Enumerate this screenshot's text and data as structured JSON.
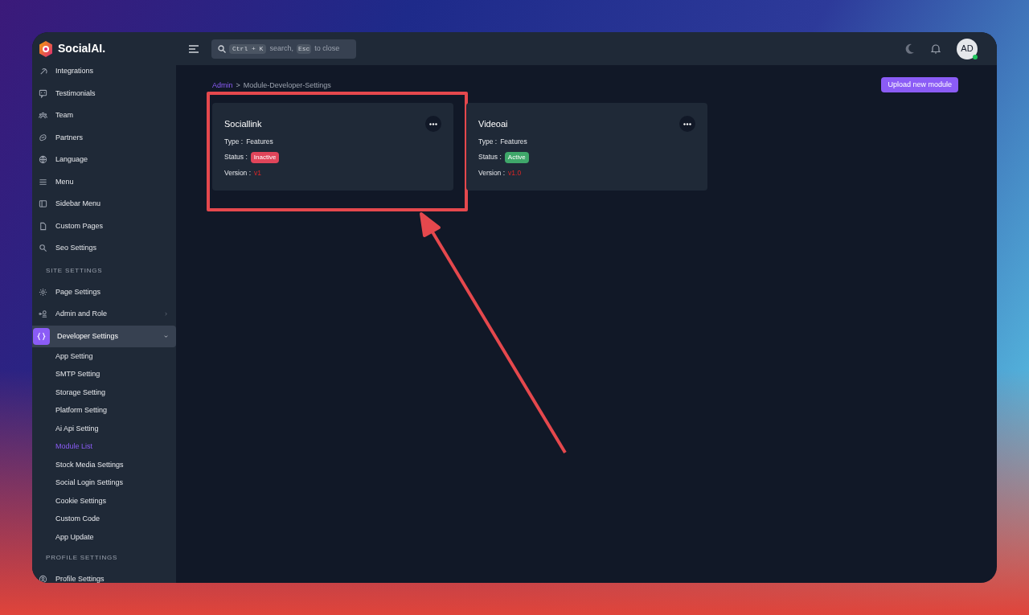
{
  "header": {
    "logo": "SocialAI.",
    "search": {
      "shortcut_key": "Ctrl + K",
      "text_1": "search,",
      "escape_key": "Esc",
      "text_2": "to close"
    },
    "avatar": "AD",
    "online": true
  },
  "sidebar": {
    "items": [
      {
        "kind": "item",
        "label": "Integrations",
        "selected": false
      },
      {
        "kind": "item",
        "label": "Testimonials",
        "selected": false
      },
      {
        "kind": "item",
        "label": "Team",
        "selected": false
      },
      {
        "kind": "item",
        "label": "Partners",
        "selected": false
      },
      {
        "kind": "item",
        "label": "Language",
        "selected": false
      },
      {
        "kind": "item",
        "label": "Menu",
        "selected": false
      },
      {
        "kind": "item",
        "label": "Sidebar Menu",
        "selected": false
      },
      {
        "kind": "item",
        "label": "Custom Pages",
        "selected": false
      },
      {
        "kind": "item",
        "label": "Seo Settings",
        "selected": false
      },
      {
        "kind": "section",
        "label": "SITE SETTINGS"
      },
      {
        "kind": "item",
        "label": "Page Settings",
        "selected": false
      },
      {
        "kind": "group",
        "label": "Admin and Role",
        "selected": false,
        "expanded": false
      },
      {
        "kind": "group",
        "label": "Developer Settings",
        "selected": true,
        "expanded": true,
        "children": [
          {
            "label": "App Setting",
            "selected": false
          },
          {
            "label": "SMTP Setting",
            "selected": false
          },
          {
            "label": "Storage Setting",
            "selected": false
          },
          {
            "label": "Platform Setting",
            "selected": false
          },
          {
            "label": "Ai Api Setting",
            "selected": false
          },
          {
            "label": "Module List",
            "selected": true
          },
          {
            "label": "Stock Media Settings",
            "selected": false
          },
          {
            "label": "Social Login Settings",
            "selected": false
          },
          {
            "label": "Cookie Settings",
            "selected": false
          },
          {
            "label": "Custom Code",
            "selected": false
          },
          {
            "label": "App Update",
            "selected": false
          }
        ]
      },
      {
        "kind": "section",
        "label": "PROFILE SETTINGS"
      },
      {
        "kind": "item",
        "label": "Profile Settings",
        "selected": false
      }
    ]
  },
  "breadcrumb": {
    "root": "Admin",
    "separator": ">",
    "current": "Module-Developer-Settings"
  },
  "upload_button": "Upload new module",
  "modules": [
    {
      "name": "Sociallink",
      "type_label": "Type :",
      "type": "Features",
      "status_label": "Status :",
      "status": "Inactive",
      "active": false,
      "version_label": "Version :",
      "version": "v1",
      "highlighted": true
    },
    {
      "name": "Videoai",
      "type_label": "Type :",
      "type": "Features",
      "status_label": "Status :",
      "status": "Active",
      "active": true,
      "version_label": "Version :",
      "version": "v1.0",
      "highlighted": false
    }
  ]
}
